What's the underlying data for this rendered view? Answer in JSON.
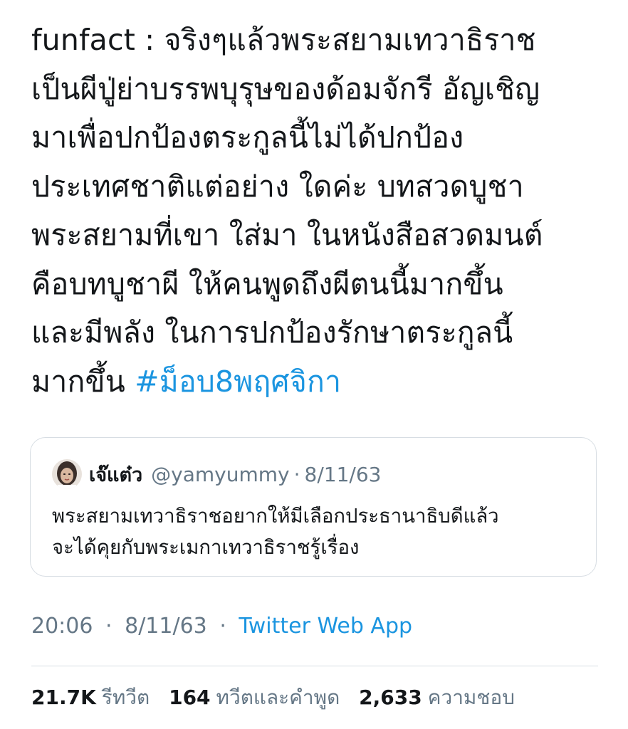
{
  "tweet": {
    "lines": [
      "funfact : จริงๆแล้วพระสยามเทวาธิราช",
      "เป็นผีปู่ย่าบรรพบุรุษของด้อมจักรี อัญเชิญ",
      "มาเพื่อปกป้องตระกูลนี้ไม่ได้ปกป้อง",
      "ประเทศชาติแต่อย่าง ใดค่ะ บทสวดบูชา",
      "พระสยามที่เขา ใส่มา ในหนังสือสวดมนต์",
      "คือบทบูชาผี ให้คนพูดถึงผีตนนี้มากขึ้น",
      "และมีพลัง ในการปกป้องรักษาตระกูลนี้"
    ],
    "last_line_text": "มากขึ้น",
    "hashtag": "#ม็อบ8พฤศจิกา"
  },
  "quote": {
    "name": "เจ๊แต๋ว",
    "handle": "@yamyummy",
    "separator": "·",
    "date": "8/11/63",
    "lines": [
      "พระสยามเทวาธิราชอยากให้มีเลือกประธานาธิบดีแล้ว",
      "จะได้คุยกับพระเมกาเทวาธิราชรู้เรื่อง"
    ]
  },
  "meta": {
    "time": "20:06",
    "separator": "·",
    "date": "8/11/63",
    "source": "Twitter Web App"
  },
  "stats": {
    "retweets_count": "21.7K",
    "retweets_label": "รีทวีต",
    "quotes_count": "164",
    "quotes_label": "ทวีตและคำพูด",
    "likes_count": "2,633",
    "likes_label": "ความชอบ"
  },
  "colors": {
    "text": "#14171a",
    "secondary": "#657786",
    "link": "#1b95e0",
    "border": "#d7dde3"
  }
}
